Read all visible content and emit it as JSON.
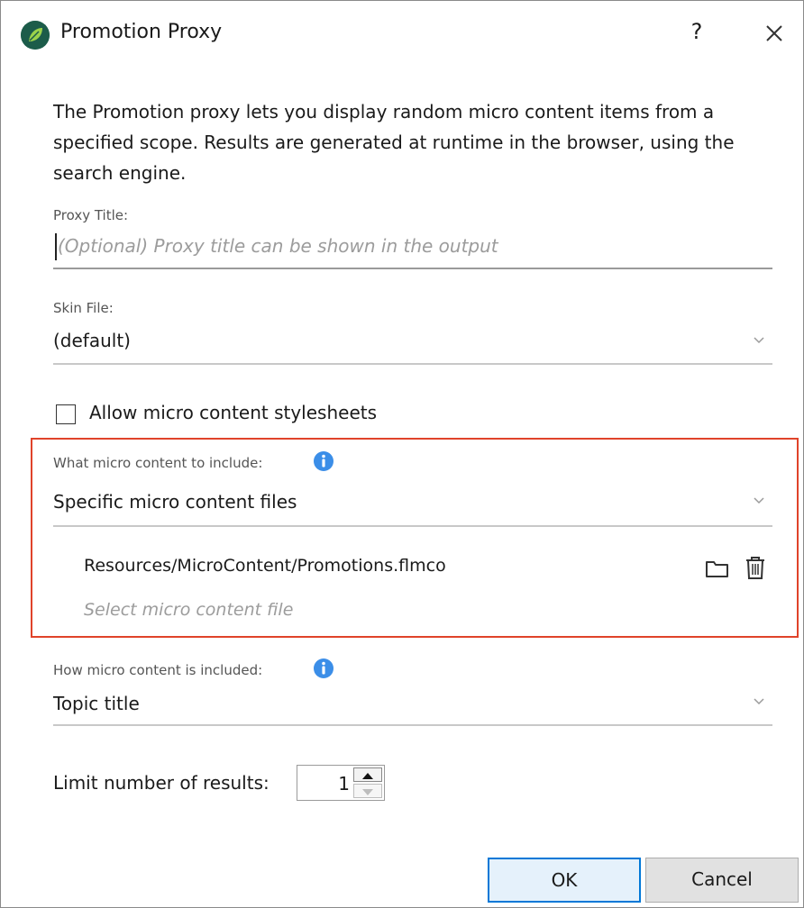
{
  "window": {
    "title": "Promotion Proxy",
    "help_label": "?",
    "icons": {
      "app": "leaf-app-icon",
      "close": "close-icon"
    }
  },
  "description": "The Promotion proxy lets you display random micro content items from a specified scope. Results are generated at runtime in the browser, using the search engine.",
  "proxy_title": {
    "label": "Proxy Title:",
    "placeholder": "(Optional) Proxy title can be shown in the output",
    "value": ""
  },
  "skin_file": {
    "label": "Skin File:",
    "value": "(default)"
  },
  "allow_stylesheets": {
    "label": "Allow micro content stylesheets",
    "checked": false
  },
  "what_to_include": {
    "label": "What micro content to include:",
    "value": "Specific micro content files",
    "files": [
      {
        "path": "Resources/MicroContent/Promotions.flmco"
      }
    ],
    "select_placeholder": "Select micro content file",
    "icons": {
      "browse": "folder-icon",
      "delete": "trash-icon",
      "info": "info-icon"
    }
  },
  "how_included": {
    "label": "How micro content is included:",
    "value": "Topic title"
  },
  "limit": {
    "label": "Limit number of results:",
    "value": "1"
  },
  "buttons": {
    "ok": "OK",
    "cancel": "Cancel"
  },
  "colors": {
    "highlight_border": "#e0432a",
    "info_blue": "#3b8ee8",
    "ok_border": "#0078d7"
  }
}
